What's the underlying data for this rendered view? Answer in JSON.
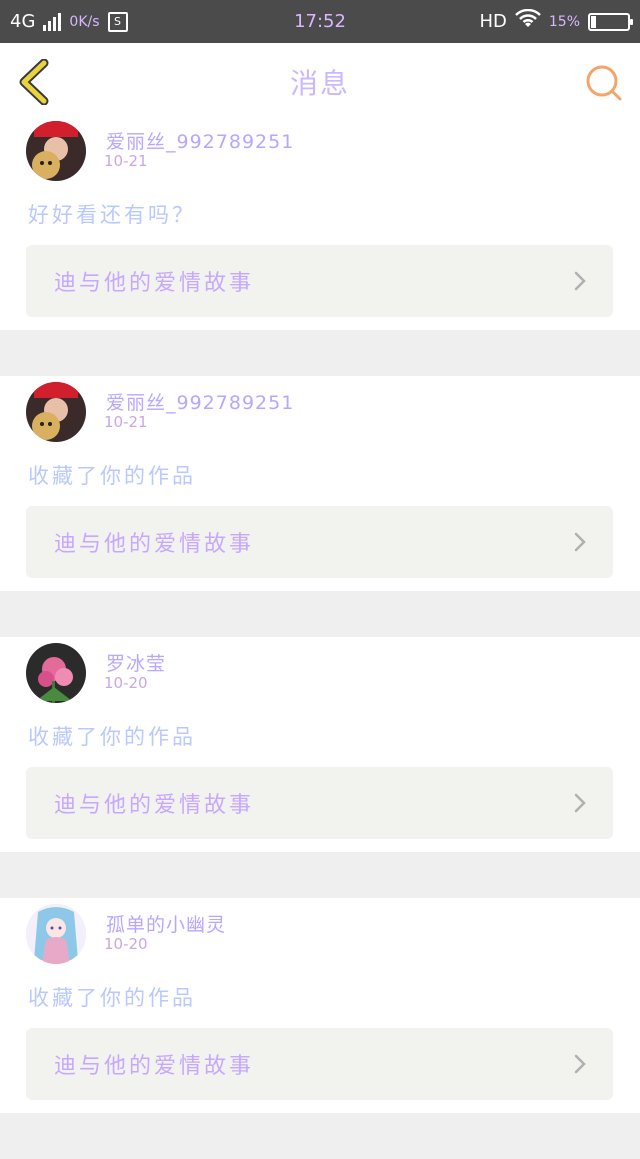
{
  "status_bar": {
    "network": "4G",
    "net_speed": "0K/s",
    "sim_label": "S",
    "time": "17:52",
    "hd": "HD",
    "battery_percent": "15%",
    "battery_level": 0.15,
    "icons": [
      "signal-icon",
      "sim-icon",
      "wifi-icon",
      "battery-icon"
    ]
  },
  "nav": {
    "title": "消息",
    "back_icon": "chevron-left-icon",
    "search_icon": "search-icon"
  },
  "messages": [
    {
      "user": "爱丽丝_992789251",
      "date": "10-21",
      "text": "好好看还有吗？",
      "work": "迪与他的爱情故事"
    },
    {
      "user": "爱丽丝_992789251",
      "date": "10-21",
      "text": "收藏了你的作品",
      "work": "迪与他的爱情故事"
    },
    {
      "user": "罗冰莹",
      "date": "10-20",
      "text": "收藏了你的作品",
      "work": "迪与他的爱情故事"
    },
    {
      "user": "孤单的小幽灵",
      "date": "10-20",
      "text": "收藏了你的作品",
      "work": "迪与他的爱情故事"
    }
  ],
  "colors": {
    "accent_orange": "#f4a46b",
    "back_yellow": "#e9d43e",
    "text_purple": "#b9a6ff",
    "status_bar": "#4b4b4b"
  }
}
